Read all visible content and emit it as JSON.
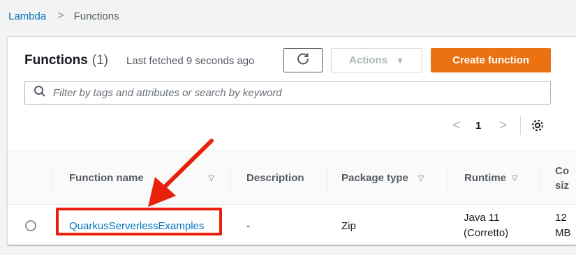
{
  "breadcrumb": {
    "root": "Lambda",
    "separator": ">",
    "current": "Functions"
  },
  "header": {
    "title": "Functions",
    "count": "(1)",
    "last_fetched": "Last fetched 9 seconds ago",
    "actions_label": "Actions",
    "create_label": "Create function"
  },
  "search": {
    "placeholder": "Filter by tags and attributes or search by keyword"
  },
  "pagination": {
    "current_page": "1"
  },
  "table": {
    "columns": [
      "Function name",
      "Description",
      "Package type",
      "Runtime",
      "Co",
      "siz"
    ],
    "rows": [
      {
        "function_name": "QuarkusServerlessExamples",
        "description": "-",
        "package_type": "Zip",
        "runtime_line1": "Java 11",
        "runtime_line2": "(Corretto)",
        "code_size_line1": "12",
        "code_size_line2": "MB"
      }
    ]
  },
  "colors": {
    "link": "#0073bb",
    "primary": "#ec7211",
    "annotation": "#e8200c"
  },
  "icons": [
    "refresh-icon",
    "caret-down-icon",
    "search-icon",
    "chevron-left-icon",
    "chevron-right-icon",
    "gear-icon",
    "sort-icon"
  ]
}
